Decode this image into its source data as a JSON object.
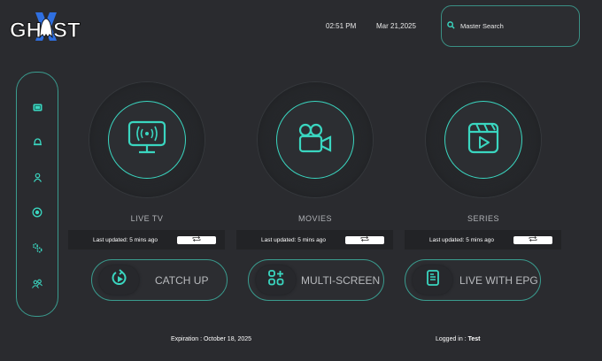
{
  "logo_text": "GHOST X",
  "header": {
    "time": "02:51 PM",
    "date": "Mar 21,2025",
    "search_placeholder": "Master Search"
  },
  "sidebar": [
    "tv-guide-icon",
    "bell-icon",
    "user-icon",
    "record-icon",
    "settings-icon",
    "users-icon"
  ],
  "tiles": [
    {
      "label": "LIVE TV",
      "updated": "Last updated: 5 mins ago",
      "icon": "tv-broadcast-icon"
    },
    {
      "label": "MOVIES",
      "updated": "Last updated: 5 mins ago",
      "icon": "video-camera-icon"
    },
    {
      "label": "SERIES",
      "updated": "Last updated: 5 mins ago",
      "icon": "clapperboard-icon"
    }
  ],
  "buttons": [
    {
      "label": "CATCH UP"
    },
    {
      "label": "MULTI-SCREEN"
    },
    {
      "label": "LIVE WITH EPG"
    }
  ],
  "footer": {
    "expiration": "Expiration : October 18, 2025",
    "logged_label": "Logged in : ",
    "user": "Test"
  },
  "colors": {
    "accent": "#3ad6c0",
    "bg": "#2a2b2f"
  }
}
